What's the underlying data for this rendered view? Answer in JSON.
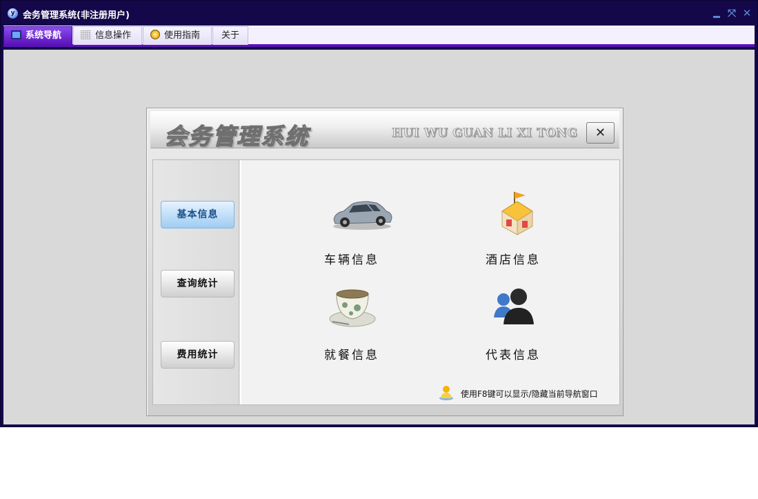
{
  "window": {
    "title": "会务管理系统(非注册用户)",
    "controls": [
      "minimize-icon",
      "restore-icon",
      "close-icon"
    ]
  },
  "tabs": [
    {
      "label": "系统导航",
      "icon": "monitor-icon",
      "active": true
    },
    {
      "label": "信息操作",
      "icon": "grid-icon",
      "active": false
    },
    {
      "label": "使用指南",
      "icon": "guide-icon",
      "active": false
    },
    {
      "label": "关于",
      "icon": "",
      "active": false
    }
  ],
  "dialog": {
    "title": "会务管理系统",
    "subtitle": "HUI WU GUAN LI XI TONG",
    "close_label": "✕"
  },
  "sidebar": {
    "items": [
      {
        "label": "基本信息",
        "active": true
      },
      {
        "label": "查询统计",
        "active": false
      },
      {
        "label": "费用统计",
        "active": false
      }
    ]
  },
  "tiles": [
    {
      "label": "车辆信息",
      "icon": "car-icon"
    },
    {
      "label": "酒店信息",
      "icon": "hotel-icon"
    },
    {
      "label": "就餐信息",
      "icon": "teacup-icon"
    },
    {
      "label": "代表信息",
      "icon": "users-icon"
    }
  ],
  "hint": {
    "text": "使用F8键可以显示/隐藏当前导航窗口",
    "icon": "user-hint-icon"
  },
  "colors": {
    "frame": "#14084a",
    "tab_accent": "#5a12b8",
    "workarea": "#d9d9d9",
    "active_side": "#9fcdf2"
  }
}
